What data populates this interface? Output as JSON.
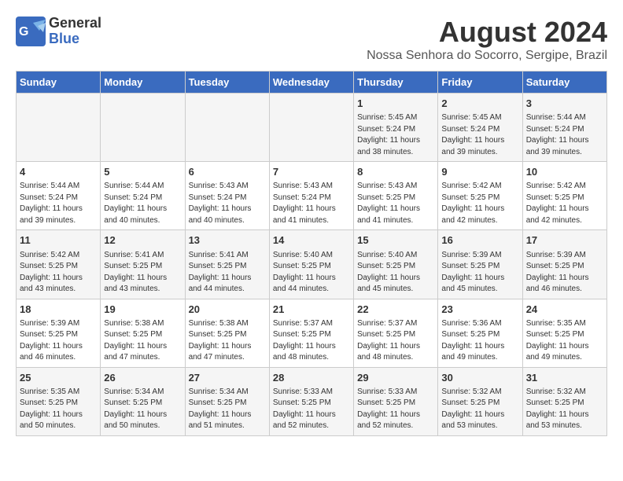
{
  "header": {
    "logo_line1": "General",
    "logo_line2": "Blue",
    "month_year": "August 2024",
    "location": "Nossa Senhora do Socorro, Sergipe, Brazil"
  },
  "days_of_week": [
    "Sunday",
    "Monday",
    "Tuesday",
    "Wednesday",
    "Thursday",
    "Friday",
    "Saturday"
  ],
  "weeks": [
    [
      {
        "day": "",
        "info": ""
      },
      {
        "day": "",
        "info": ""
      },
      {
        "day": "",
        "info": ""
      },
      {
        "day": "",
        "info": ""
      },
      {
        "day": "1",
        "info": "Sunrise: 5:45 AM\nSunset: 5:24 PM\nDaylight: 11 hours and 38 minutes."
      },
      {
        "day": "2",
        "info": "Sunrise: 5:45 AM\nSunset: 5:24 PM\nDaylight: 11 hours and 39 minutes."
      },
      {
        "day": "3",
        "info": "Sunrise: 5:44 AM\nSunset: 5:24 PM\nDaylight: 11 hours and 39 minutes."
      }
    ],
    [
      {
        "day": "4",
        "info": "Sunrise: 5:44 AM\nSunset: 5:24 PM\nDaylight: 11 hours and 39 minutes."
      },
      {
        "day": "5",
        "info": "Sunrise: 5:44 AM\nSunset: 5:24 PM\nDaylight: 11 hours and 40 minutes."
      },
      {
        "day": "6",
        "info": "Sunrise: 5:43 AM\nSunset: 5:24 PM\nDaylight: 11 hours and 40 minutes."
      },
      {
        "day": "7",
        "info": "Sunrise: 5:43 AM\nSunset: 5:24 PM\nDaylight: 11 hours and 41 minutes."
      },
      {
        "day": "8",
        "info": "Sunrise: 5:43 AM\nSunset: 5:25 PM\nDaylight: 11 hours and 41 minutes."
      },
      {
        "day": "9",
        "info": "Sunrise: 5:42 AM\nSunset: 5:25 PM\nDaylight: 11 hours and 42 minutes."
      },
      {
        "day": "10",
        "info": "Sunrise: 5:42 AM\nSunset: 5:25 PM\nDaylight: 11 hours and 42 minutes."
      }
    ],
    [
      {
        "day": "11",
        "info": "Sunrise: 5:42 AM\nSunset: 5:25 PM\nDaylight: 11 hours and 43 minutes."
      },
      {
        "day": "12",
        "info": "Sunrise: 5:41 AM\nSunset: 5:25 PM\nDaylight: 11 hours and 43 minutes."
      },
      {
        "day": "13",
        "info": "Sunrise: 5:41 AM\nSunset: 5:25 PM\nDaylight: 11 hours and 44 minutes."
      },
      {
        "day": "14",
        "info": "Sunrise: 5:40 AM\nSunset: 5:25 PM\nDaylight: 11 hours and 44 minutes."
      },
      {
        "day": "15",
        "info": "Sunrise: 5:40 AM\nSunset: 5:25 PM\nDaylight: 11 hours and 45 minutes."
      },
      {
        "day": "16",
        "info": "Sunrise: 5:39 AM\nSunset: 5:25 PM\nDaylight: 11 hours and 45 minutes."
      },
      {
        "day": "17",
        "info": "Sunrise: 5:39 AM\nSunset: 5:25 PM\nDaylight: 11 hours and 46 minutes."
      }
    ],
    [
      {
        "day": "18",
        "info": "Sunrise: 5:39 AM\nSunset: 5:25 PM\nDaylight: 11 hours and 46 minutes."
      },
      {
        "day": "19",
        "info": "Sunrise: 5:38 AM\nSunset: 5:25 PM\nDaylight: 11 hours and 47 minutes."
      },
      {
        "day": "20",
        "info": "Sunrise: 5:38 AM\nSunset: 5:25 PM\nDaylight: 11 hours and 47 minutes."
      },
      {
        "day": "21",
        "info": "Sunrise: 5:37 AM\nSunset: 5:25 PM\nDaylight: 11 hours and 48 minutes."
      },
      {
        "day": "22",
        "info": "Sunrise: 5:37 AM\nSunset: 5:25 PM\nDaylight: 11 hours and 48 minutes."
      },
      {
        "day": "23",
        "info": "Sunrise: 5:36 AM\nSunset: 5:25 PM\nDaylight: 11 hours and 49 minutes."
      },
      {
        "day": "24",
        "info": "Sunrise: 5:35 AM\nSunset: 5:25 PM\nDaylight: 11 hours and 49 minutes."
      }
    ],
    [
      {
        "day": "25",
        "info": "Sunrise: 5:35 AM\nSunset: 5:25 PM\nDaylight: 11 hours and 50 minutes."
      },
      {
        "day": "26",
        "info": "Sunrise: 5:34 AM\nSunset: 5:25 PM\nDaylight: 11 hours and 50 minutes."
      },
      {
        "day": "27",
        "info": "Sunrise: 5:34 AM\nSunset: 5:25 PM\nDaylight: 11 hours and 51 minutes."
      },
      {
        "day": "28",
        "info": "Sunrise: 5:33 AM\nSunset: 5:25 PM\nDaylight: 11 hours and 52 minutes."
      },
      {
        "day": "29",
        "info": "Sunrise: 5:33 AM\nSunset: 5:25 PM\nDaylight: 11 hours and 52 minutes."
      },
      {
        "day": "30",
        "info": "Sunrise: 5:32 AM\nSunset: 5:25 PM\nDaylight: 11 hours and 53 minutes."
      },
      {
        "day": "31",
        "info": "Sunrise: 5:32 AM\nSunset: 5:25 PM\nDaylight: 11 hours and 53 minutes."
      }
    ]
  ]
}
